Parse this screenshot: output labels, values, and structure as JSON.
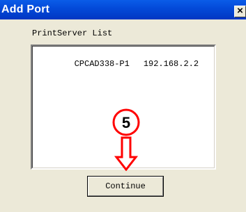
{
  "window": {
    "title": "Add Port",
    "close_glyph": "×"
  },
  "list": {
    "label": "PrintServer List",
    "items": [
      {
        "name": "CPCAD338-P1",
        "ip": "192.168.2.2"
      }
    ]
  },
  "buttons": {
    "continue_label": "Continue"
  },
  "callout": {
    "step_number": "5",
    "circle_color": "#ff0000",
    "arrow_color": "#ff0000",
    "arrow_direction": "down"
  }
}
